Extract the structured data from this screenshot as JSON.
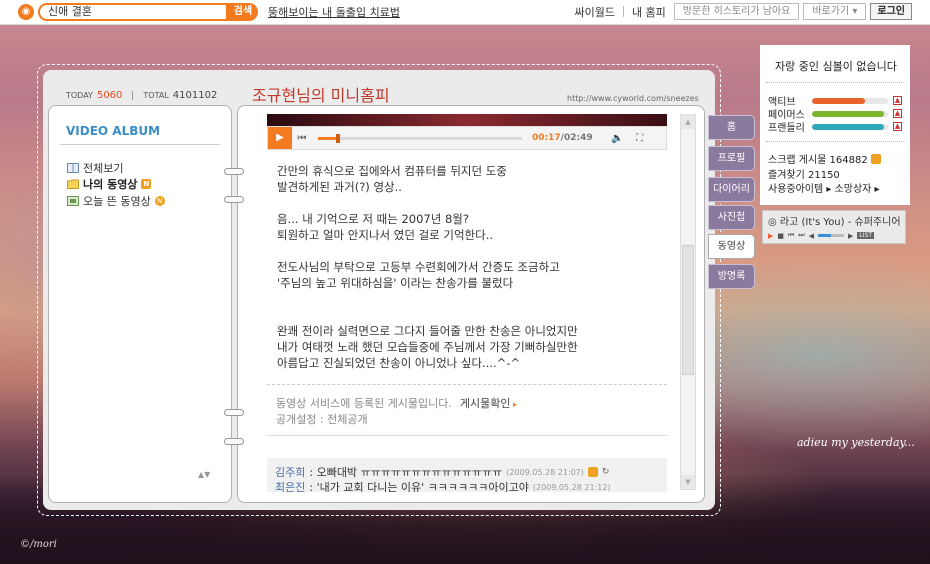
{
  "topbar": {
    "search_value": "신애 결혼",
    "search_button": "검색",
    "promo_link": "뚱해보이는 내 돌출입 치료법",
    "links": [
      "싸이월드",
      "내 홈피"
    ],
    "history_placeholder": "방문한 히스토리가 남아요",
    "shortcut_label": "바로가기",
    "login_label": "로그인"
  },
  "home": {
    "today_label": "TODAY",
    "today_count": "5060",
    "total_label": "TOTAL",
    "total_count": "4101102",
    "title": "조규현님의 미니홈피",
    "url": "http://www.cyworld.com/sneezes"
  },
  "album": {
    "title": "VIDEO ALBUM",
    "items": [
      {
        "label": "전체보기",
        "badge": ""
      },
      {
        "label": "나의 동영상",
        "badge": "N"
      },
      {
        "label": "오늘 뜬 동영상",
        "badge": "N"
      }
    ]
  },
  "player": {
    "time_current": "00:17",
    "time_total": "/02:49",
    "progress": 0.1
  },
  "post": {
    "lines": [
      "간만의 휴식으로 집에와서 컴퓨터를 뒤지던 도중",
      "발견하게된 과거(?) 영상..",
      "",
      "음... 내 기억으로 저 때는 2007년 8월?",
      "퇴원하고 얼마 안지나서 였던 걸로 기억한다..",
      "",
      "전도사님의 부탁으로 고등부 수련회에가서 간증도 조금하고",
      "'주님의 높고 위대하심을' 이라는 찬송가를 불렀다",
      "",
      "",
      "완쾌 전이라 실력면으로 그다지 들어줄 만한 찬송은 아니었지만",
      "내가 여태껏 노래 했던 모습들중에 주님께서 가장 기뻐하실만한",
      "아름답고 진실되었던 찬송이 아니었나 싶다....^-^"
    ],
    "service_text": "동영상 서비스에 등록된 게시물입니다.",
    "service_link": "게시물확인",
    "public_setting": "공개설정 : 전체공개"
  },
  "comments": [
    {
      "author": "김주희",
      "text": ": 오빠대박 ㅠㅠㅠㅠㅠㅠㅠㅠㅠㅠㅠㅠㅠㅠ",
      "time": "(2009.05.28 21:07)"
    },
    {
      "author": "최은진",
      "text": ": '내가 교회 다니는 이유' ㅋㅋㅋㅋㅋㅋ아이고야",
      "time": "(2009.05.28 21:12)"
    }
  ],
  "tabs": [
    "홈",
    "프로필",
    "다이어리",
    "사진첩",
    "동영상",
    "방명록"
  ],
  "active_tab": "동영상",
  "widget": {
    "title": "자랑 중인 심볼이 없습니다",
    "meters": [
      {
        "label": "액티브",
        "value": 0.7,
        "color": "#e8632c"
      },
      {
        "label": "페이머스",
        "value": 0.95,
        "color": "#7bb62d"
      },
      {
        "label": "프랜들리",
        "value": 0.95,
        "color": "#2fa6b9"
      }
    ],
    "scrap": "스크랩 게시물 164882",
    "favorite": "즐겨찾기 21150",
    "items": "사용중아이템 ▸ 소망상자 ▸"
  },
  "music": {
    "title": "라고 (It's You) - 슈퍼주니어",
    "volume": 0.5,
    "list_label": "LIST"
  },
  "signature": "adieu my yesterday...",
  "credit": "©/mori"
}
